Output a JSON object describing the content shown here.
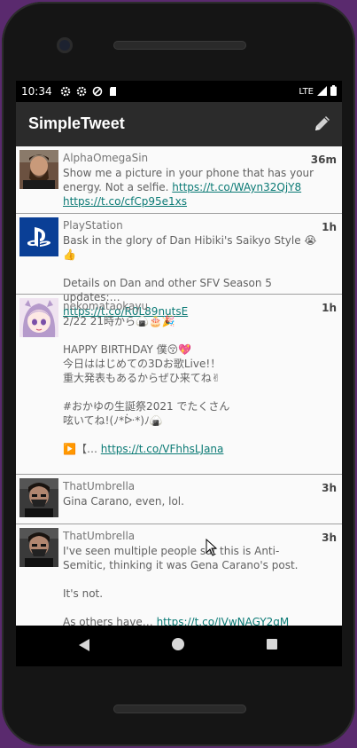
{
  "status": {
    "time": "10:34",
    "network": "LTE"
  },
  "app": {
    "title": "SimpleTweet"
  },
  "tweets": [
    {
      "name": "AlphaOmegaSin",
      "ago": "36m",
      "text": "Show me a picture in your phone that has your energy. Not a selfie. ",
      "link1": "https://t.co/WAyn32QjY8",
      "link2": "https://t.co/cfCp95e1xs"
    },
    {
      "name": "PlayStation",
      "ago": "1h",
      "text": "Bask in the glory of Dan Hibiki's Saikyo Style 😭👍\n\nDetails on Dan and other SFV Season 5 updates:…\n",
      "link1": "https://t.co/R0L89nutsE"
    },
    {
      "name": "nekomataokayu",
      "ago": "1h",
      "text": "2/22 21時から🍙🎂🎉\n\nHAPPY BIRTHDAY 僕😚💖\n今日ははじめての3Dお歌Live!！\n重大発表もあるからぜひ来てね✌\n\n#おかゆの生誕祭2021 でたくさん\n呟いてね!(ﾉ*ᐕ*)ﾉ🍙\n\n▶️【… ",
      "link1": "https://t.co/VFhhsLJana"
    },
    {
      "name": "ThatUmbrella",
      "ago": "3h",
      "text": "Gina Carano, even, lol."
    },
    {
      "name": "ThatUmbrella",
      "ago": "3h",
      "text": "I've seen multiple people sat this is Anti-Semitic, thinking it was Gena Carano's post.\n\nIt's not.\n\nAs others have… ",
      "link1": "https://t.co/IVwNAGY2gM"
    }
  ],
  "colors": {
    "appbar": "#2b2b2b",
    "link": "#0b7a75",
    "background": "#fafafa"
  },
  "icons": {
    "compose": "pencil-icon",
    "status": [
      "gear-icon",
      "gear-icon",
      "data-saver-icon",
      "sd-card-icon",
      "signal-icon",
      "battery-icon"
    ],
    "nav": [
      "back-icon",
      "home-icon",
      "recents-icon"
    ]
  }
}
